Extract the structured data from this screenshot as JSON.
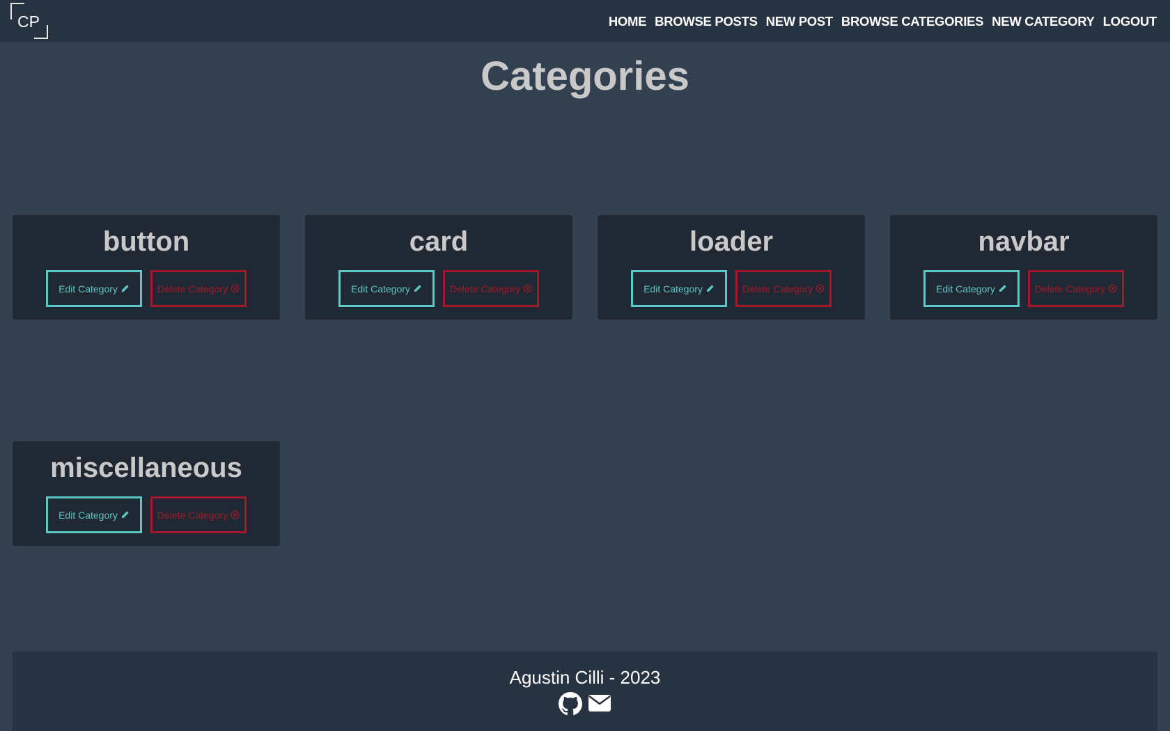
{
  "header": {
    "logo_text": "CP",
    "nav": [
      {
        "label": "HOME"
      },
      {
        "label": "BROWSE POSTS"
      },
      {
        "label": "NEW POST"
      },
      {
        "label": "BROWSE CATEGORIES"
      },
      {
        "label": "NEW CATEGORY"
      },
      {
        "label": "LOGOUT"
      }
    ]
  },
  "page": {
    "title": "Categories"
  },
  "categories": [
    {
      "name": "button",
      "edit_label": "Edit Category",
      "delete_label": "Delete Category"
    },
    {
      "name": "card",
      "edit_label": "Edit Category",
      "delete_label": "Delete Category"
    },
    {
      "name": "loader",
      "edit_label": "Edit Category",
      "delete_label": "Delete Category"
    },
    {
      "name": "navbar",
      "edit_label": "Edit Category",
      "delete_label": "Delete Category"
    },
    {
      "name": "miscellaneous",
      "edit_label": "Edit Category",
      "delete_label": "Delete Category"
    }
  ],
  "icons": {
    "edit": "pencil-icon",
    "delete": "circle-x-icon",
    "footer": [
      "github-icon",
      "envelope-icon"
    ]
  },
  "colors": {
    "background": "#334050",
    "navbar": "#273341",
    "card": "#1f2833",
    "edit_accent": "#5cc7c4",
    "delete_accent": "#a11a2c",
    "title_text": "#c9c9c9"
  },
  "footer": {
    "text": "Agustin Cilli - 2023"
  }
}
